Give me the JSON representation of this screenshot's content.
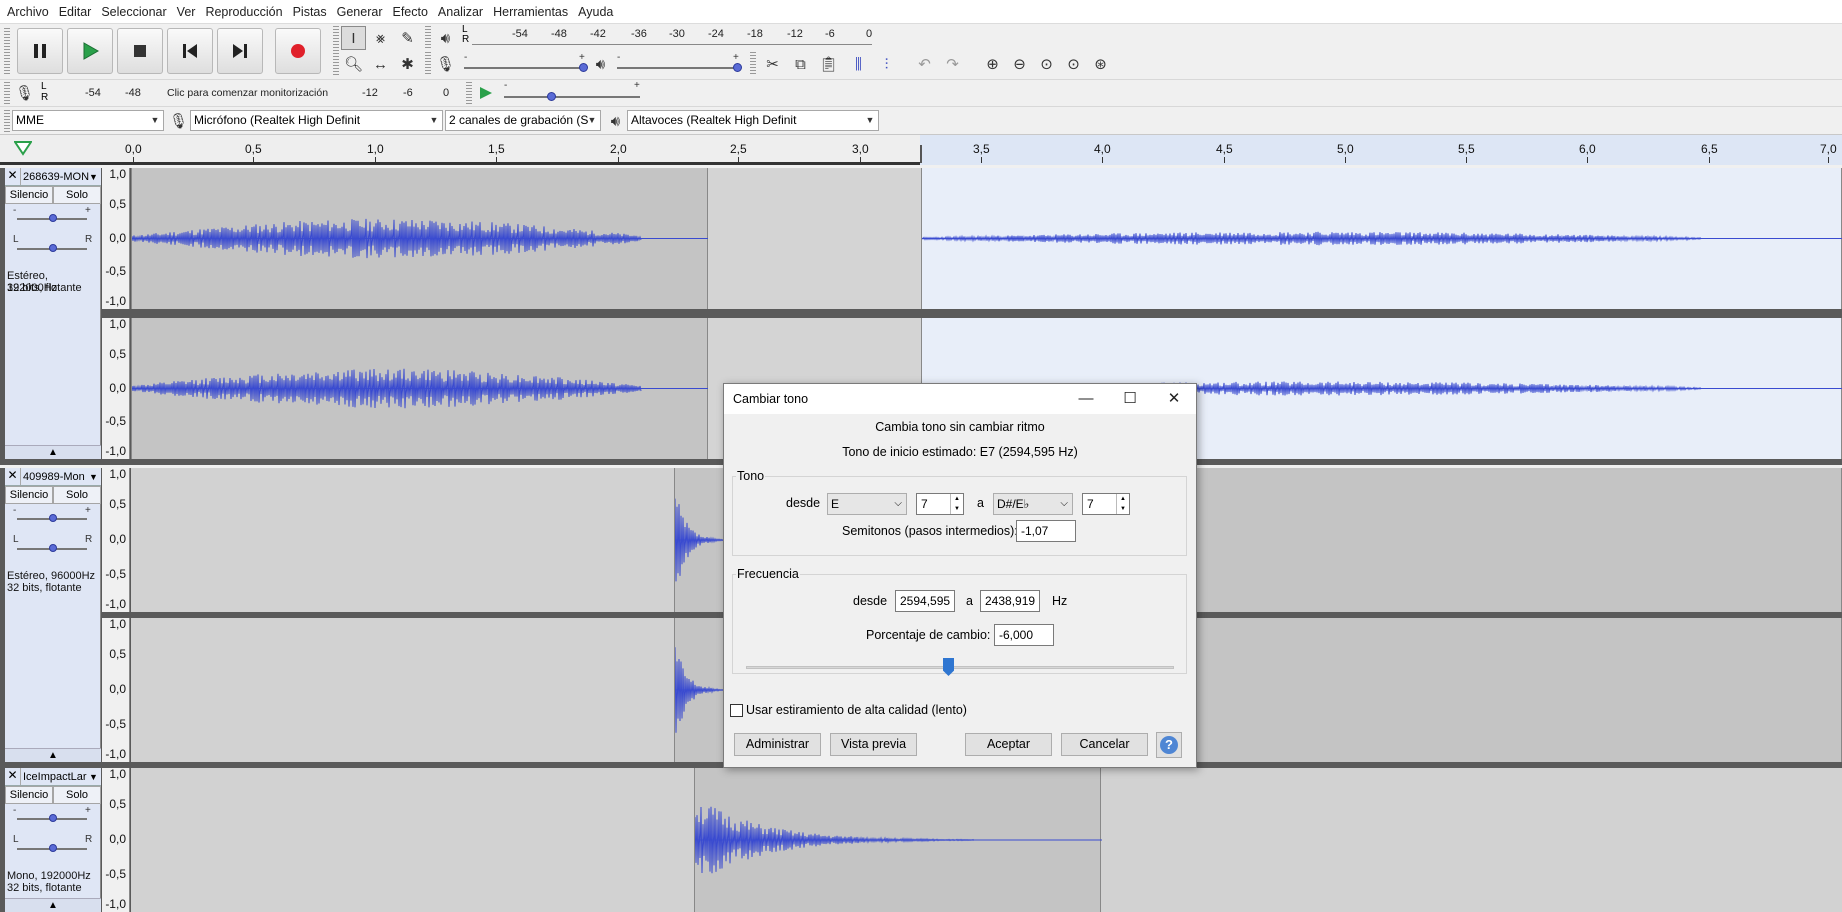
{
  "menu": [
    "Archivo",
    "Editar",
    "Seleccionar",
    "Ver",
    "Reproducción",
    "Pistas",
    "Generar",
    "Efecto",
    "Analizar",
    "Herramientas",
    "Ayuda"
  ],
  "meters": {
    "playback_scale": [
      "-54",
      "-48",
      "-42",
      "-36",
      "-30",
      "-24",
      "-18",
      "-12",
      "-6",
      "0"
    ],
    "record_scale": [
      "-54",
      "-48",
      "-12",
      "-6",
      "0"
    ],
    "record_hint": "Clic para comenzar monitorización",
    "lr_top": "L",
    "lr_bottom": "R"
  },
  "devices": {
    "host": "MME",
    "mic": "Micrófono (Realtek High Definit",
    "channels": "2 canales de grabación (S",
    "speakers": "Altavoces (Realtek High Definit"
  },
  "ruler": {
    "ticks": [
      "0,0",
      "0,5",
      "1,0",
      "1,5",
      "2,0",
      "2,5",
      "3,0",
      "3,5",
      "4,0",
      "4,5",
      "5,0",
      "5,5",
      "6,0",
      "6,5",
      "7,0"
    ]
  },
  "tracks": [
    {
      "name": "268639-MON",
      "mute": "Silencio",
      "solo": "Solo",
      "info1": "Estéreo, 192000Hz",
      "info2": "32 bits, flotante",
      "scale": [
        "1,0",
        "0,5",
        "0,0",
        "-0,5",
        "-1,0"
      ]
    },
    {
      "name": "409989-Mon",
      "mute": "Silencio",
      "solo": "Solo",
      "info1": "Estéreo, 96000Hz",
      "info2": "32 bits, flotante",
      "scale": [
        "1,0",
        "0,5",
        "0,0",
        "-0,5",
        "-1,0"
      ]
    },
    {
      "name": "IceImpactLar",
      "mute": "Silencio",
      "solo": "Solo",
      "info1": "Mono, 192000Hz",
      "info2": "32 bits, flotante",
      "scale": [
        "1,0",
        "0,5",
        "0,0",
        "-0,5",
        "-1,0"
      ]
    }
  ],
  "slider_labels": {
    "minus": "-",
    "plus": "+",
    "left": "L",
    "right": "R"
  },
  "dialog": {
    "title": "Cambiar tono",
    "subtitle": "Cambia tono sin cambiar ritmo",
    "estimated": "Tono de inicio estimado: E7 (2594,595 Hz)",
    "pitch_group": "Tono",
    "from_label": "desde",
    "to_label": "a",
    "from_note": "E",
    "from_octave": "7",
    "to_note": "D#/E♭",
    "to_octave": "7",
    "semitones_label": "Semitonos (pasos intermedios):",
    "semitones_value": "-1,07",
    "freq_group": "Frecuencia",
    "freq_from": "2594,595",
    "freq_to": "2438,919",
    "freq_unit": "Hz",
    "percent_label": "Porcentaje de cambio:",
    "percent_value": "-6,000",
    "percent_slider": -6.0,
    "hq_label": "Usar estiramiento de alta calidad (lento)",
    "hq_checked": false,
    "btn_manage": "Administrar",
    "btn_preview": "Vista previa",
    "btn_ok": "Aceptar",
    "btn_cancel": "Cancelar",
    "help": "?"
  },
  "colors": {
    "waveform": "#3a4bd0",
    "selection": "#e8eef9",
    "record": "#e0202a",
    "play": "#2aa04a"
  }
}
